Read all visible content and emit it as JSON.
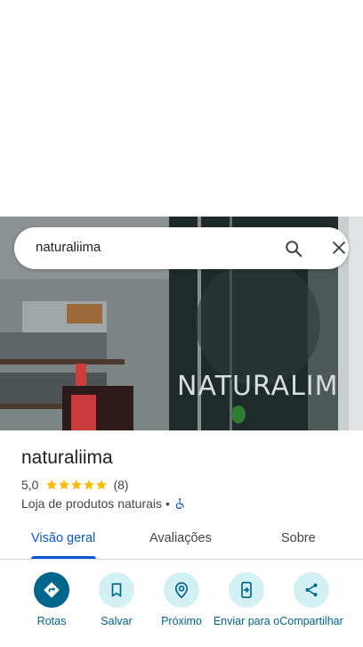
{
  "search": {
    "query": "naturaliima"
  },
  "photo": {
    "storefront_sign": "NATURALIMA"
  },
  "place": {
    "name": "naturaliima",
    "rating": "5,0",
    "stars": 5,
    "review_count": "(8)",
    "category": "Loja de produtos naturais",
    "separator": "•"
  },
  "tabs": [
    {
      "label": "Visão geral",
      "active": true
    },
    {
      "label": "Avaliações",
      "active": false
    },
    {
      "label": "Sobre",
      "active": false
    }
  ],
  "actions": [
    {
      "label": "Rotas",
      "icon": "directions-icon"
    },
    {
      "label": "Salvar",
      "icon": "bookmark-icon"
    },
    {
      "label": "Próximo",
      "icon": "nearby-icon"
    },
    {
      "label": "Enviar para o",
      "icon": "send-to-phone-icon"
    },
    {
      "label": "Compartilhar",
      "icon": "share-icon"
    }
  ],
  "colors": {
    "accent": "#0b57d0",
    "action_bg": "#d3f0f5",
    "action_primary": "#00658b",
    "star": "#fbbc04"
  }
}
